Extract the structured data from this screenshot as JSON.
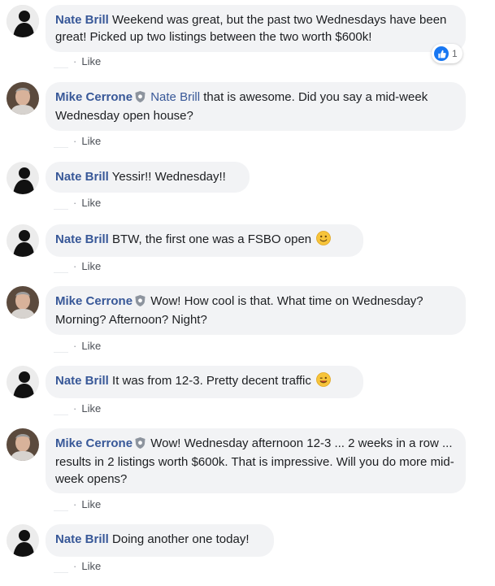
{
  "comments": [
    {
      "author": "Nate Brill",
      "avatar": "dark",
      "text": "Weekend was great, but the past two Wednesdays have been great! Picked up two listings between the two worth $600k!",
      "like": "Like",
      "reactions": "1"
    },
    {
      "author": "Mike Cerrone",
      "avatar": "light",
      "verified": true,
      "mention": "Nate Brill",
      "text": "that is awesome. Did you say a mid-week Wednesday open house?",
      "like": "Like"
    },
    {
      "author": "Nate Brill",
      "avatar": "dark",
      "text": "Yessir!! Wednesday!!",
      "like": "Like"
    },
    {
      "author": "Nate Brill",
      "avatar": "dark",
      "text": "BTW, the first one was a FSBO open",
      "emoji": "smile",
      "like": "Like"
    },
    {
      "author": "Mike Cerrone",
      "avatar": "light",
      "verified": true,
      "text": "Wow! How cool is that. What time on Wednesday? Morning? Afternoon? Night?",
      "like": "Like"
    },
    {
      "author": "Nate Brill",
      "avatar": "dark",
      "text": "It was from 12-3. Pretty decent traffic",
      "emoji": "wink",
      "like": "Like"
    },
    {
      "author": "Mike Cerrone",
      "avatar": "light",
      "verified": true,
      "text": "Wow! Wednesday afternoon 12-3 ... 2 weeks in a row ... results in 2 listings worth $600k. That is impressive. Will you do more mid-week opens?",
      "like": "Like"
    },
    {
      "author": "Nate Brill",
      "avatar": "dark",
      "text": "Doing another one today!",
      "like": "Like"
    }
  ],
  "colors": {
    "author": "#385898",
    "bubble": "#f2f3f5",
    "meta": "#90949c",
    "like_reaction": "#1877f2"
  },
  "icons": [
    "verified-shield-icon",
    "like-reaction-icon",
    "smile-emoji-icon",
    "wink-emoji-icon"
  ]
}
